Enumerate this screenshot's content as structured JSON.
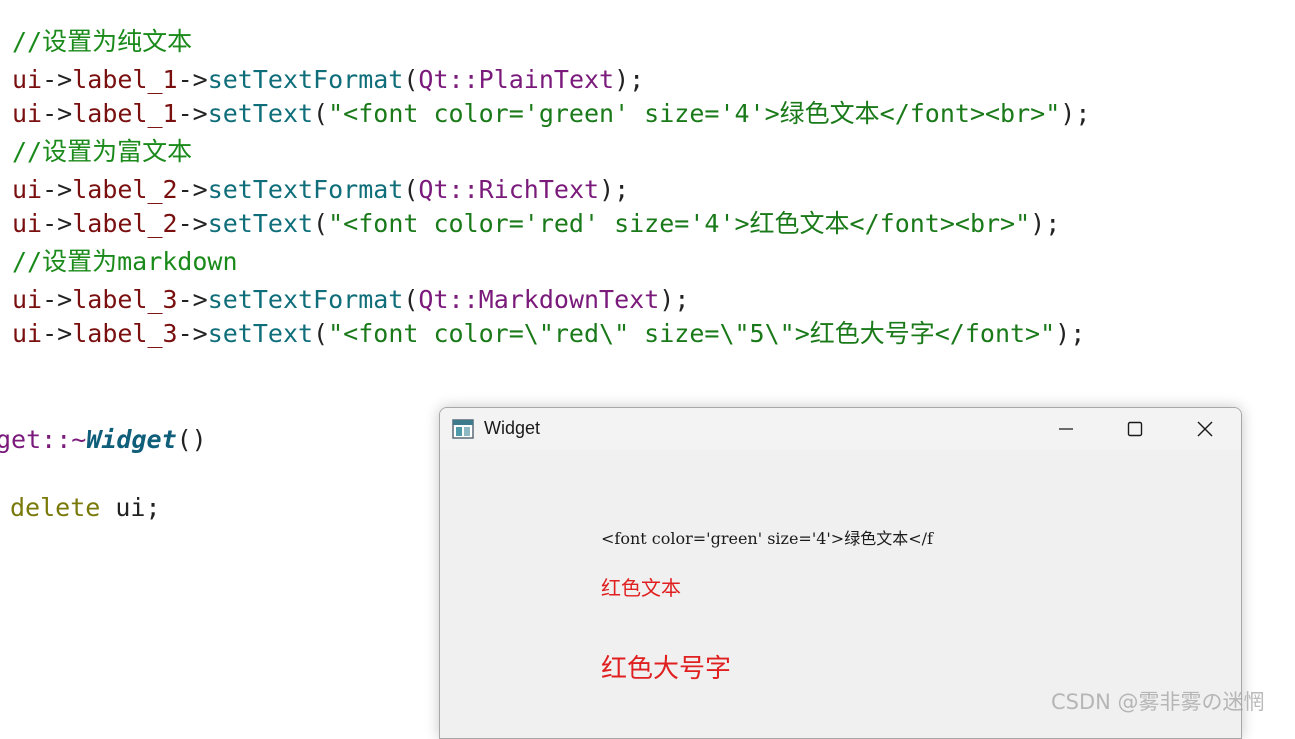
{
  "code": {
    "lines": [
      {
        "kind": "comment",
        "text": "//设置为纯文本"
      },
      {
        "kind": "call",
        "obj": "ui",
        "arrow1": "->",
        "field": "label_1",
        "arrow2": "->",
        "method": "setTextFormat",
        "open": "(",
        "ns": "Qt::",
        "enum": "PlainText",
        "close": ");"
      },
      {
        "kind": "settext",
        "obj": "ui",
        "arrow1": "->",
        "field": "label_1",
        "arrow2": "->",
        "method": "setText",
        "open": "(",
        "str": "\"<font color='green' size='4'>绿色文本</font><br>\"",
        "close": ");"
      },
      {
        "kind": "comment",
        "text": "//设置为富文本"
      },
      {
        "kind": "call",
        "obj": "ui",
        "arrow1": "->",
        "field": "label_2",
        "arrow2": "->",
        "method": "setTextFormat",
        "open": "(",
        "ns": "Qt::",
        "enum": "RichText",
        "close": ");"
      },
      {
        "kind": "settext",
        "obj": "ui",
        "arrow1": "->",
        "field": "label_2",
        "arrow2": "->",
        "method": "setText",
        "open": "(",
        "str": "\"<font color='red' size='4'>红色文本</font><br>\"",
        "close": ");"
      },
      {
        "kind": "comment",
        "text": "//设置为markdown"
      },
      {
        "kind": "call",
        "obj": "ui",
        "arrow1": "->",
        "field": "label_3",
        "arrow2": "->",
        "method": "setTextFormat",
        "open": "(",
        "ns": "Qt::",
        "enum": "MarkdownText",
        "close": ");"
      },
      {
        "kind": "settext",
        "obj": "ui",
        "arrow1": "->",
        "field": "label_3",
        "arrow2": "->",
        "method": "setText",
        "open": "(",
        "str": "\"<font color=\\\"red\\\" size=\\\"5\\\">红色大号字</font>\"",
        "close": ");"
      }
    ],
    "destructor": {
      "class_part": "get::~",
      "name": "Widget",
      "parens": "()"
    },
    "delete_kw": "delete",
    "delete_rest": " ui;"
  },
  "window": {
    "title": "Widget",
    "app_icon": "qt-window-icon",
    "controls": {
      "minimize": "minimize-icon",
      "maximize": "maximize-icon",
      "close": "close-icon"
    },
    "label_1_text": "<font color='green' size='4'>绿色文本</f",
    "label_2_text": "红色文本",
    "label_3_text": "红色大号字"
  },
  "watermark": "CSDN @雾非雾の迷惘",
  "colors": {
    "label_red": "#e02020",
    "comment_green": "#1a8a1a",
    "method_teal": "#0f6e7a"
  }
}
